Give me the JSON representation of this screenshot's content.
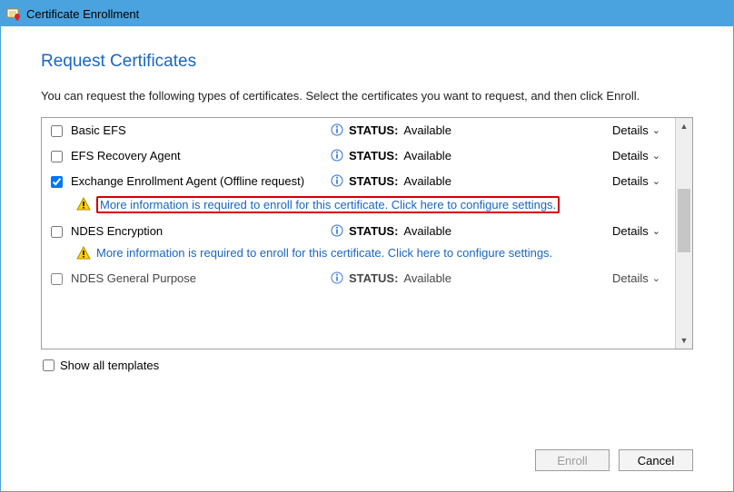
{
  "window": {
    "title": "Certificate Enrollment"
  },
  "page": {
    "heading": "Request Certificates",
    "instruction": "You can request the following types of certificates. Select the certificates you want to request, and then click Enroll."
  },
  "status_label": "STATUS:",
  "details_label": "Details",
  "warn_text": "More information is required to enroll for this certificate. Click here to configure settings.",
  "certs": [
    {
      "name": "Basic EFS",
      "status": "Available",
      "checked": false
    },
    {
      "name": "EFS Recovery Agent",
      "status": "Available",
      "checked": false
    },
    {
      "name": "Exchange Enrollment Agent (Offline request)",
      "status": "Available",
      "checked": true,
      "warn": true,
      "highlighted": true
    },
    {
      "name": "NDES Encryption",
      "status": "Available",
      "checked": false,
      "warn": true
    },
    {
      "name": "NDES General Purpose",
      "status": "Available",
      "checked": false
    }
  ],
  "show_all_label": "Show all templates",
  "buttons": {
    "enroll": "Enroll",
    "cancel": "Cancel"
  }
}
